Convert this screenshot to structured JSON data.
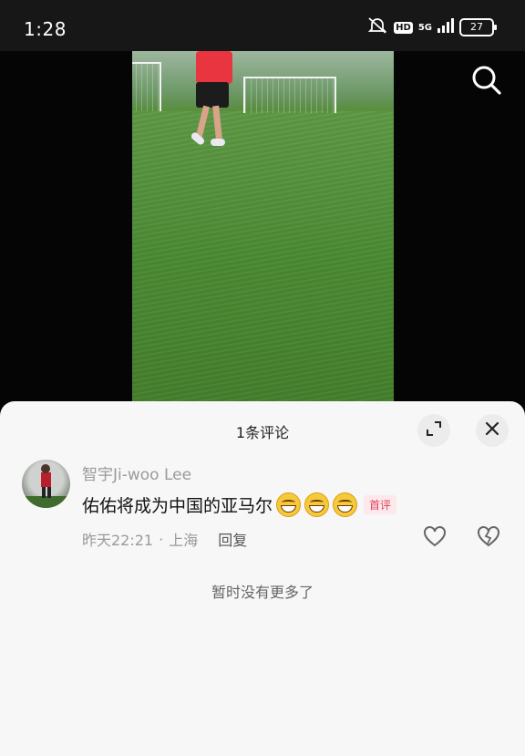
{
  "status_bar": {
    "time": "1:28",
    "hd_label": "HD",
    "network": "5G",
    "battery": "27",
    "icons": [
      "mute-vibrate-icon",
      "hd-icon",
      "signal-5g-icon",
      "battery-icon"
    ]
  },
  "video": {
    "search_icon": "search-icon"
  },
  "comments": {
    "title": "1条评论",
    "expand_icon": "expand-icon",
    "close_icon": "close-icon",
    "items": [
      {
        "username": "智宇Ji-woo Lee",
        "text": "佑佑将成为中国的亚马尔",
        "emoji_count": 3,
        "emoji": "grinning-face",
        "badge": "首评",
        "time": "昨天22:21",
        "separator": "·",
        "location": "上海",
        "reply_label": "回复"
      }
    ],
    "no_more_text": "暂时没有更多了"
  },
  "colors": {
    "badge_text": "#e0415a",
    "badge_bg": "#fde8ec",
    "sheet_bg": "#f7f7f7",
    "status_bg": "#171717"
  }
}
